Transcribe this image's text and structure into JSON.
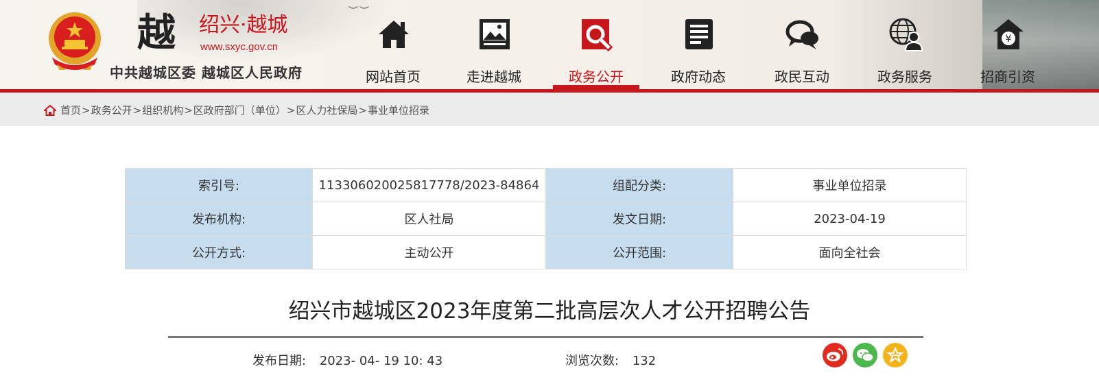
{
  "site": {
    "title": "绍兴·越城",
    "url": "www.sxyc.gov.cn",
    "subtitle": "中共越城区委 越城区人民政府",
    "logo_char": "越"
  },
  "nav": [
    {
      "label": "网站首页",
      "icon": "home-icon",
      "active": false
    },
    {
      "label": "走进越城",
      "icon": "picture-icon",
      "active": false
    },
    {
      "label": "政务公开",
      "icon": "search-document-icon",
      "active": true
    },
    {
      "label": "政府动态",
      "icon": "news-icon",
      "active": false
    },
    {
      "label": "政民互动",
      "icon": "chat-bubbles-icon",
      "active": false
    },
    {
      "label": "政务服务",
      "icon": "globe-user-icon",
      "active": false
    },
    {
      "label": "招商引资",
      "icon": "yuan-house-icon",
      "active": false
    }
  ],
  "breadcrumb": {
    "items": [
      "首页",
      "政务公开",
      "组织机构",
      "区政府部门（单位）",
      "区人力社保局",
      "事业单位招录"
    ],
    "separator": ">"
  },
  "info_table": {
    "rows": [
      [
        {
          "k": "索引号:",
          "v": "113306020025817778/2023-84864"
        },
        {
          "k": "组配分类:",
          "v": "事业单位招录"
        }
      ],
      [
        {
          "k": "发布机构:",
          "v": "区人社局"
        },
        {
          "k": "发文日期:",
          "v": "2023-04-19"
        }
      ],
      [
        {
          "k": "公开方式:",
          "v": "主动公开"
        },
        {
          "k": "公开范围:",
          "v": "面向全社会"
        }
      ]
    ]
  },
  "article": {
    "title": "绍兴市越城区2023年度第二批高层次人才公开招聘公告",
    "publish_label": "发布日期:",
    "publish_value": "2023- 04- 19 10: 43",
    "views_label": "浏览次数:",
    "views_value": "132"
  },
  "share": [
    {
      "name": "weibo",
      "icon": "weibo-icon"
    },
    {
      "name": "wechat",
      "icon": "wechat-icon"
    },
    {
      "name": "favorite",
      "icon": "star-icon"
    }
  ],
  "colors": {
    "accent": "#c8161d",
    "table_key_bg": "#c6ddef",
    "weibo": "#e02b1e",
    "wechat": "#4cb84b",
    "favorite": "#f2b31b"
  }
}
